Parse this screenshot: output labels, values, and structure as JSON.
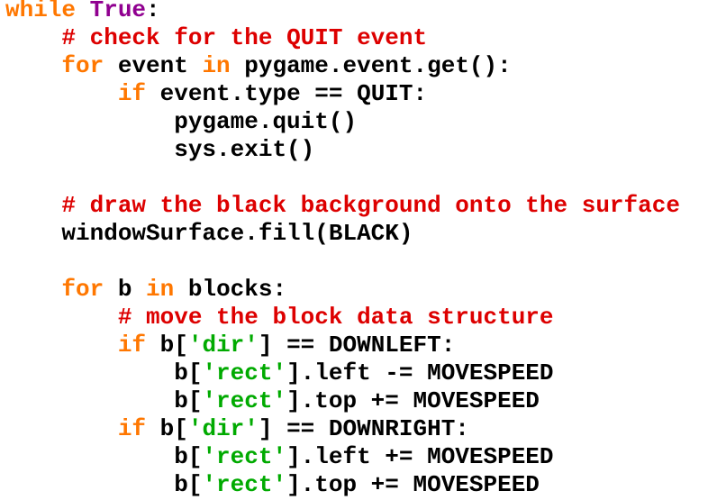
{
  "colors": {
    "keyword": "#ff7700",
    "builtin": "#900090",
    "comment": "#dd0000",
    "string": "#00aa00",
    "text": "#000000",
    "background": "#ffffff"
  },
  "code": {
    "lines": [
      [
        {
          "t": "while",
          "k": "kw"
        },
        {
          "t": " ",
          "k": "plain"
        },
        {
          "t": "True",
          "k": "builtin"
        },
        {
          "t": ":",
          "k": "plain"
        }
      ],
      [
        {
          "t": "    ",
          "k": "plain"
        },
        {
          "t": "# check for the QUIT event",
          "k": "comment"
        }
      ],
      [
        {
          "t": "    ",
          "k": "plain"
        },
        {
          "t": "for",
          "k": "kw"
        },
        {
          "t": " event ",
          "k": "plain"
        },
        {
          "t": "in",
          "k": "kw"
        },
        {
          "t": " pygame.event.get():",
          "k": "plain"
        }
      ],
      [
        {
          "t": "        ",
          "k": "plain"
        },
        {
          "t": "if",
          "k": "kw"
        },
        {
          "t": " event.type == QUIT:",
          "k": "plain"
        }
      ],
      [
        {
          "t": "            pygame.quit()",
          "k": "plain"
        }
      ],
      [
        {
          "t": "            sys.exit()",
          "k": "plain"
        }
      ],
      [],
      [
        {
          "t": "    ",
          "k": "plain"
        },
        {
          "t": "# draw the black background onto the surface",
          "k": "comment"
        }
      ],
      [
        {
          "t": "    windowSurface.fill(BLACK)",
          "k": "plain"
        }
      ],
      [],
      [
        {
          "t": "    ",
          "k": "plain"
        },
        {
          "t": "for",
          "k": "kw"
        },
        {
          "t": " b ",
          "k": "plain"
        },
        {
          "t": "in",
          "k": "kw"
        },
        {
          "t": " blocks:",
          "k": "plain"
        }
      ],
      [
        {
          "t": "        ",
          "k": "plain"
        },
        {
          "t": "# move the block data structure",
          "k": "comment"
        }
      ],
      [
        {
          "t": "        ",
          "k": "plain"
        },
        {
          "t": "if",
          "k": "kw"
        },
        {
          "t": " b[",
          "k": "plain"
        },
        {
          "t": "'dir'",
          "k": "str"
        },
        {
          "t": "] == DOWNLEFT:",
          "k": "plain"
        }
      ],
      [
        {
          "t": "            b[",
          "k": "plain"
        },
        {
          "t": "'rect'",
          "k": "str"
        },
        {
          "t": "].left -= MOVESPEED",
          "k": "plain"
        }
      ],
      [
        {
          "t": "            b[",
          "k": "plain"
        },
        {
          "t": "'rect'",
          "k": "str"
        },
        {
          "t": "].top += MOVESPEED",
          "k": "plain"
        }
      ],
      [
        {
          "t": "        ",
          "k": "plain"
        },
        {
          "t": "if",
          "k": "kw"
        },
        {
          "t": " b[",
          "k": "plain"
        },
        {
          "t": "'dir'",
          "k": "str"
        },
        {
          "t": "] == DOWNRIGHT:",
          "k": "plain"
        }
      ],
      [
        {
          "t": "            b[",
          "k": "plain"
        },
        {
          "t": "'rect'",
          "k": "str"
        },
        {
          "t": "].left += MOVESPEED",
          "k": "plain"
        }
      ],
      [
        {
          "t": "            b[",
          "k": "plain"
        },
        {
          "t": "'rect'",
          "k": "str"
        },
        {
          "t": "].top += MOVESPEED",
          "k": "plain"
        }
      ]
    ]
  }
}
